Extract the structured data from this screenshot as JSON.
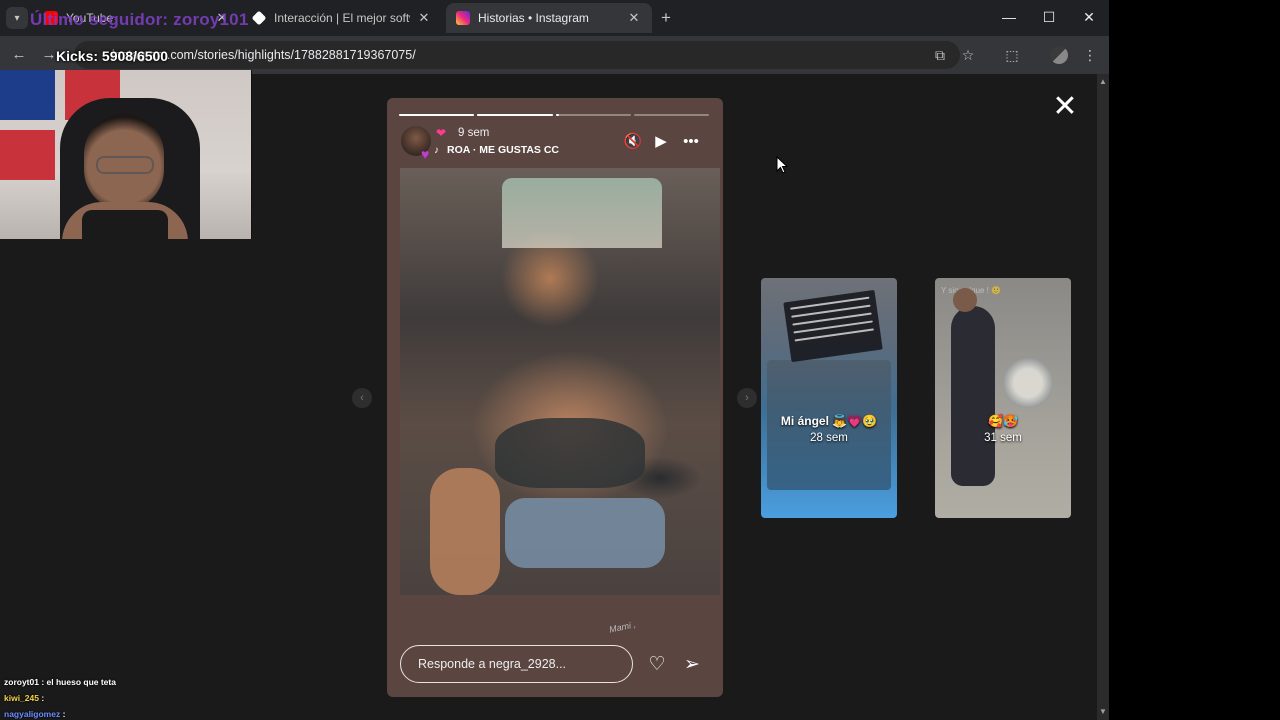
{
  "browser": {
    "tabs": [
      {
        "label": "YouTube",
        "favicon_color": "#ff0000"
      },
      {
        "label": "Interacción | El mejor software",
        "favicon_color": "#ffffff"
      },
      {
        "label": "Historias • Instagram",
        "favicon_color": "#e1306c",
        "active": true
      }
    ],
    "tab_close_glyph": "✕",
    "new_tab_glyph": "+",
    "window_controls": {
      "minimize": "—",
      "maximize": "☐",
      "close": "✕"
    },
    "url": "instagram.com/stories/highlights/17882881719367075/",
    "icons": [
      "back-arrow-icon",
      "forward-arrow-icon",
      "reload-icon",
      "install-app-icon",
      "bookmark-star-icon",
      "extensions-icon",
      "profile-icon",
      "kebab-menu-icon"
    ]
  },
  "overlay": {
    "last_follower": "Último seguidor: zoroy101",
    "kicks": "Kicks: 5908/6500",
    "chat": [
      {
        "user": "zoroyt01",
        "msg": ": el hueso que teta",
        "color": "#ffffff"
      },
      {
        "user": "kiwi_245",
        "msg": ":",
        "color": "#f3d24a"
      },
      {
        "user": "nagyaligomez",
        "msg": ":",
        "color": "#6a8cff"
      }
    ]
  },
  "story": {
    "progress": [
      1.0,
      1.0,
      0.05,
      0.0
    ],
    "time": "9 sem",
    "song": "ROA · ME GUSTAS CC",
    "sticker_text": "Mami ,",
    "reply_placeholder": "Responde a negra_2928...",
    "controls": [
      "mute-icon",
      "play-icon",
      "more-options-icon"
    ],
    "close_glyph": "✕"
  },
  "highlights": [
    {
      "title": "Mi ángel 👼💗🥹",
      "time": "28 sem"
    },
    {
      "title": "🥰🥵",
      "time": "31 sem",
      "top_text": "Y sigo sigue ! 🙂"
    }
  ],
  "colors": {
    "accent": "#ffffff",
    "card_bg": "#5a4540",
    "page_bg": "#1a1a1a"
  }
}
